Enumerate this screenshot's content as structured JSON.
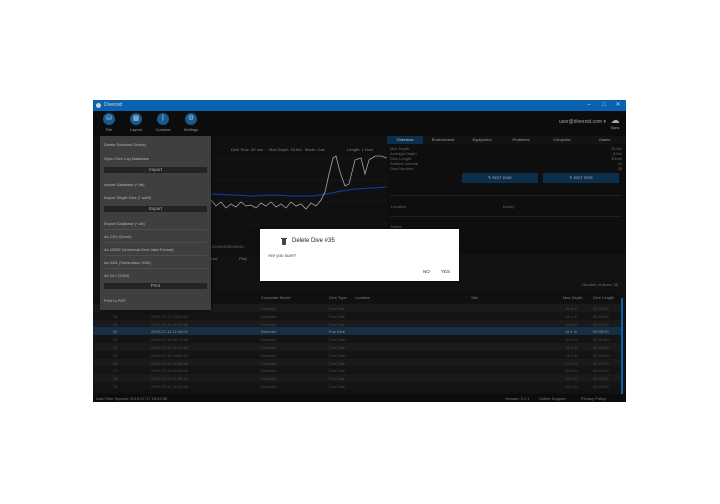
{
  "window": {
    "title": "Diveroid",
    "minimize": "–",
    "maximize": "□",
    "close": "✕"
  },
  "toolbar": {
    "items": [
      {
        "label": "File",
        "icon": "⛁"
      },
      {
        "label": "Layout",
        "icon": "▦"
      },
      {
        "label": "Connect",
        "icon": "ᛒ"
      },
      {
        "label": "Settings",
        "icon": "⚙"
      }
    ],
    "account": "user@diveroid.com ▾",
    "sync_label": "Sync",
    "sync_icon": "☁"
  },
  "menu": {
    "items": [
      {
        "type": "item",
        "label": "Delete Selected Dive(s)"
      },
      {
        "type": "item",
        "label": "Open Dive Log Database"
      },
      {
        "type": "section",
        "label": "Import"
      },
      {
        "type": "item",
        "label": "Import Database (*.db)"
      },
      {
        "type": "item",
        "label": "Import Single Dive (*.uddf)"
      },
      {
        "type": "section",
        "label": "Export"
      },
      {
        "type": "item",
        "label": "Export Database (*.db)"
      },
      {
        "type": "item",
        "label": "As CSV (Excel)"
      },
      {
        "type": "item",
        "label": "As UDDF (Universal Dive Data Format)"
      },
      {
        "type": "item",
        "label": "As XML (Subsurface XML)"
      },
      {
        "type": "item",
        "label": "As DL7 (DAN)"
      },
      {
        "type": "section",
        "label": "Print"
      },
      {
        "type": "item",
        "label": "Print to PDF"
      }
    ]
  },
  "profile": {
    "stats": [
      "Dive Time: 30 min",
      "Max Depth: 15.8m",
      "Mode: Gas",
      "Length: 1 Hour"
    ],
    "time_start": "00:00:00",
    "time_mid": "00:08:00",
    "buttons": [
      "Preview",
      "Play"
    ]
  },
  "info": {
    "tabs": [
      "Overview",
      "Environment",
      "Equipment",
      "Problems",
      "Computer",
      "Gases"
    ],
    "rows": [
      {
        "label": "Max Depth",
        "value": "15.8m"
      },
      {
        "label": "Average Depth",
        "value": "8.5m"
      },
      {
        "label": "Dive Length",
        "value": "30min"
      },
      {
        "label": "Surface Interval",
        "value": "1h"
      },
      {
        "label": "Dive Number",
        "value": "35"
      }
    ],
    "btn_left": "✎ EDIT DIVE",
    "btn_right": "✎ EDIT SITE",
    "field_location": "Location",
    "field_buddy": "Buddy",
    "field_notes": "Notes"
  },
  "table": {
    "header": [
      "#",
      "Date & Time",
      "Computer Model",
      "Dive Type",
      "Location",
      "Site",
      "Max Depth",
      "Dive Length"
    ],
    "count_label": "Number of dives: 35",
    "rows": [
      {
        "num": "35",
        "date": "2019-07-17 15:28:35",
        "model": "Diveroid",
        "type": "Fun Dive",
        "depth": "15.8 m",
        "length": "00:30:00"
      },
      {
        "num": "34",
        "date": "2019-07-17 13:20:10",
        "model": "Diveroid",
        "type": "Fun Dive",
        "depth": "14.2 m",
        "length": "00:28:00"
      },
      {
        "num": "33",
        "date": "2019-07-16 16:05:48",
        "model": "Diveroid",
        "type": "Fun Dive",
        "depth": "12.6 m",
        "length": "00:25:00"
      },
      {
        "num": "32",
        "date": "2019-07-16 11:44:02",
        "model": "Diveroid",
        "type": "Fun Dive",
        "depth": "18.1 m",
        "length": "00:35:00"
      },
      {
        "num": "31",
        "date": "2019-07-15 15:12:30",
        "model": "Diveroid",
        "type": "Fun Dive",
        "depth": "11.9 m",
        "length": "00:31:00"
      },
      {
        "num": "30",
        "date": "2019-07-15 10:31:55",
        "model": "Diveroid",
        "type": "Fun Dive",
        "depth": "16.4 m",
        "length": "00:29:00"
      },
      {
        "num": "29",
        "date": "2019-07-14 14:50:17",
        "model": "Diveroid",
        "type": "Fun Dive",
        "depth": "13.3 m",
        "length": "00:33:00"
      },
      {
        "num": "28",
        "date": "2019-07-14 09:58:40",
        "model": "Diveroid",
        "type": "Fun Dive",
        "depth": "17.0 m",
        "length": "00:27:00"
      },
      {
        "num": "27",
        "date": "2019-07-13 15:40:06",
        "model": "Diveroid",
        "type": "Fun Dive",
        "depth": "10.5 m",
        "length": "00:24:00"
      },
      {
        "num": "26",
        "date": "2019-07-13 11:05:21",
        "model": "Diveroid",
        "type": "Fun Dive",
        "depth": "15.2 m",
        "length": "00:32:00"
      },
      {
        "num": "25",
        "date": "2019-07-12 16:20:44",
        "model": "Diveroid",
        "type": "Fun Dive",
        "depth": "12.0 m",
        "length": "00:26:00"
      }
    ]
  },
  "status": {
    "left": "Last Time Synced: 2019-07-17 15:29:35",
    "version": "Version: 0.1.1",
    "help": "Online Support",
    "privacy": "Privacy Policy"
  },
  "dialog": {
    "title": "Delete Dive #35",
    "message": "Are you sure?",
    "no": "NO",
    "yes": "YES"
  }
}
